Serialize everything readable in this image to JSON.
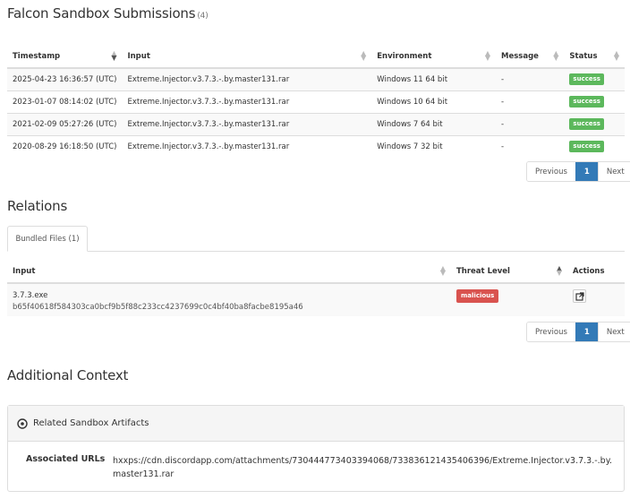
{
  "submissions": {
    "title": "Falcon Sandbox Submissions",
    "count": "(4)",
    "columns": [
      "Timestamp",
      "Input",
      "Environment",
      "Message",
      "Status"
    ],
    "rows": [
      {
        "timestamp": "2025-04-23 16:36:57 (UTC)",
        "input": "Extreme.Injector.v3.7.3.-.by.master131.rar",
        "environment": "Windows 11 64 bit",
        "message": "-",
        "status": "success"
      },
      {
        "timestamp": "2023-01-07 08:14:02 (UTC)",
        "input": "Extreme.Injector.v3.7.3.-.by.master131.rar",
        "environment": "Windows 10 64 bit",
        "message": "-",
        "status": "success"
      },
      {
        "timestamp": "2021-02-09 05:27:26 (UTC)",
        "input": "Extreme.Injector.v3.7.3.-.by.master131.rar",
        "environment": "Windows 7 64 bit",
        "message": "-",
        "status": "success"
      },
      {
        "timestamp": "2020-08-29 16:18:50 (UTC)",
        "input": "Extreme.Injector.v3.7.3.-.by.master131.rar",
        "environment": "Windows 7 32 bit",
        "message": "-",
        "status": "success"
      }
    ],
    "pager": {
      "previous": "Previous",
      "page": "1",
      "next": "Next"
    }
  },
  "relations": {
    "title": "Relations",
    "tab": "Bundled Files (1)",
    "columns": [
      "Input",
      "Threat Level",
      "Actions"
    ],
    "rows": [
      {
        "name": "3.7.3.exe",
        "hash": "b65f40618f584303ca0bcf9b5f88c233cc4237699c0c4bf40ba8facbe8195a46",
        "threat": "malicious"
      }
    ],
    "pager": {
      "previous": "Previous",
      "page": "1",
      "next": "Next"
    }
  },
  "context": {
    "title": "Additional Context",
    "panel_title": "Related Sandbox Artifacts",
    "assoc_label": "Associated URLs",
    "assoc_value": "hxxps://cdn.discordapp.com/attachments/730444773403394068/733836121435406396/Extreme.Injector.v3.7.3.-.by.master131.rar"
  },
  "colors": {
    "success": "#5cb85c",
    "malicious": "#d9534f",
    "active_page": "#337ab7"
  }
}
